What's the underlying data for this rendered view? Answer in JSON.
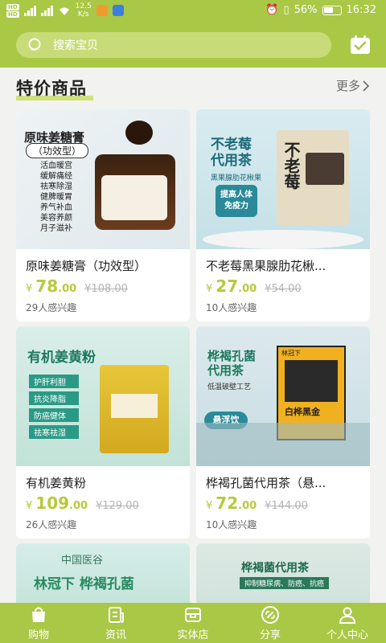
{
  "status_bar": {
    "sim1": "HD",
    "sim2": "HD",
    "net_speed_value": "12.5",
    "net_speed_unit": "K/s",
    "battery": "56%",
    "time": "16:32"
  },
  "search": {
    "placeholder": "搜索宝贝"
  },
  "section": {
    "title": "特价商品",
    "more": "更多"
  },
  "products": [
    {
      "name": "原味姜糖膏（功效型）",
      "price_int": "78",
      "price_dec": ".00",
      "old_price": "108.00",
      "interest": "29人感兴趣",
      "img": {
        "title": "原味姜糖膏",
        "subtitle": "（功效型）",
        "tags": [
          "活血暖宫",
          "缓解痛经",
          "祛寒除湿",
          "健脾暖胃",
          "养气补血",
          "美容养颜",
          "月子滋补"
        ]
      }
    },
    {
      "name": "不老莓黑果腺肋花楸...",
      "price_int": "27",
      "price_dec": ".00",
      "old_price": "54.00",
      "interest": "10人感兴趣",
      "img": {
        "title1": "不老莓",
        "title2": "代用茶",
        "subtitle": "黑果腺肋花楸果",
        "badge1": "提高人体",
        "badge2": "免疫力",
        "pack_title": "不老莓"
      }
    },
    {
      "name": "有机姜黄粉",
      "price_int": "109",
      "price_dec": ".00",
      "old_price": "129.00",
      "interest": "26人感兴趣",
      "img": {
        "title": "有机姜黄粉",
        "tags": [
          "护肝利胆",
          "抗炎降脂",
          "防癌健体",
          "祛寒祛湿"
        ]
      }
    },
    {
      "name": "桦褐孔菌代用茶（悬...",
      "price_int": "72",
      "price_dec": ".00",
      "old_price": "144.00",
      "interest": "10人感兴趣",
      "img": {
        "title1": "桦褐孔菌",
        "title2": "代用茶",
        "subtitle": "低温破壁工艺",
        "badge": "悬浮饮",
        "box_title": "白桦黑金",
        "box_brand": "林冠下"
      }
    },
    {
      "img": {
        "brand": "中国医谷",
        "title": "林冠下 桦褐孔菌"
      }
    },
    {
      "img": {
        "title": "桦褐菌代用茶",
        "subtitle": "抑制糖尿病、防癌、抗癌"
      }
    }
  ],
  "currency": "¥",
  "nav": [
    {
      "label": "购物",
      "icon": "shopping-bag-icon"
    },
    {
      "label": "资讯",
      "icon": "news-icon"
    },
    {
      "label": "实体店",
      "icon": "store-icon"
    },
    {
      "label": "分享",
      "icon": "share-icon"
    },
    {
      "label": "个人中心",
      "icon": "user-icon"
    }
  ],
  "colors": {
    "brand": "#a9c845",
    "price": "#b8c93a"
  }
}
